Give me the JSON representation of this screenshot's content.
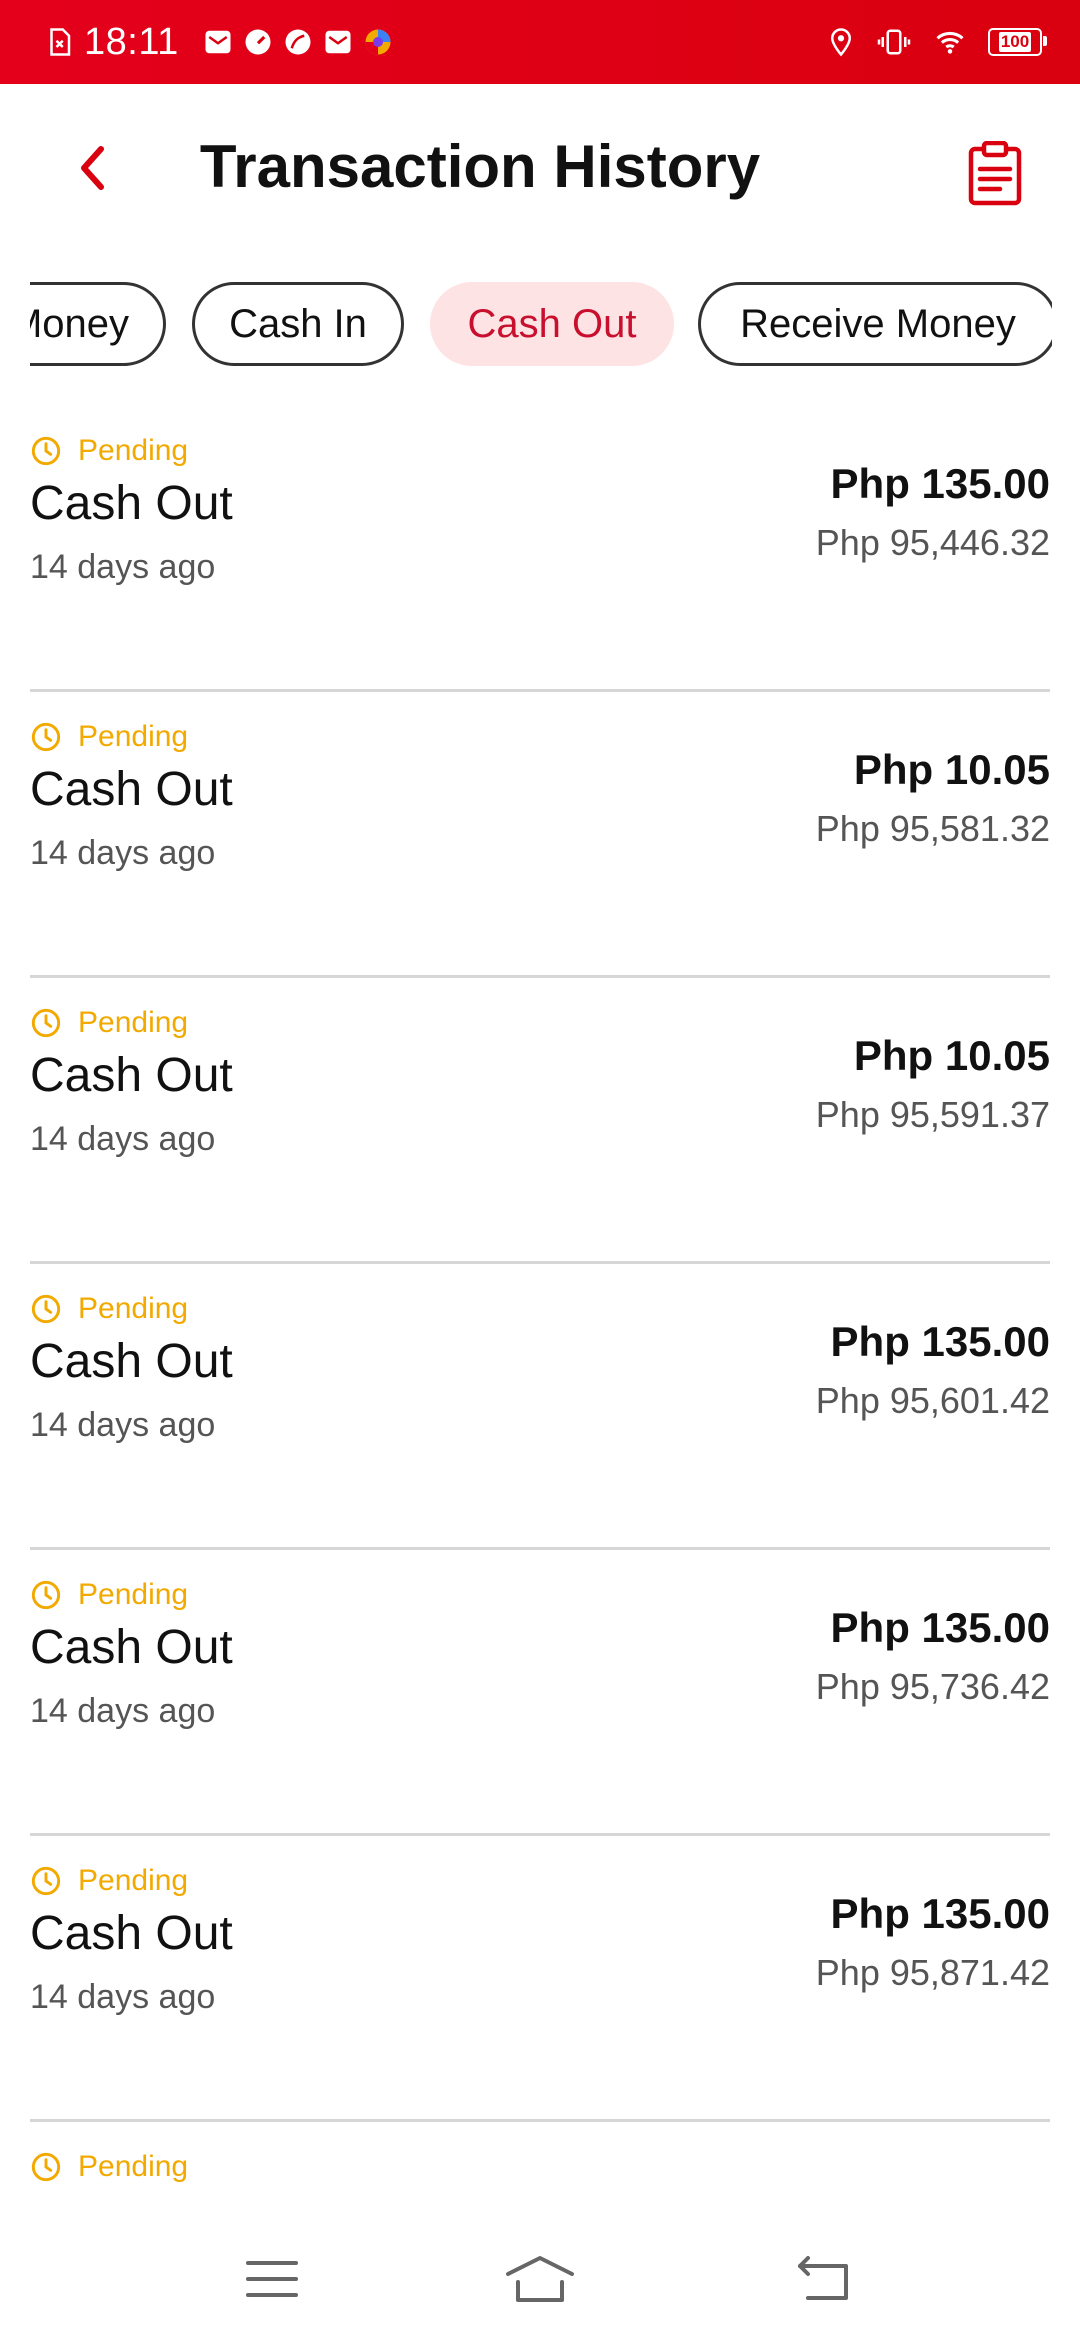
{
  "status_bar": {
    "time": "18:11",
    "battery": "100"
  },
  "header": {
    "title": "Transaction History"
  },
  "tabs": [
    {
      "label": "Money"
    },
    {
      "label": "Cash In"
    },
    {
      "label": "Cash Out"
    },
    {
      "label": "Receive Money"
    }
  ],
  "transactions": [
    {
      "status": "Pending",
      "type": "Cash Out",
      "time": "14 days ago",
      "amount": "Php 135.00",
      "balance": "Php 95,446.32"
    },
    {
      "status": "Pending",
      "type": "Cash Out",
      "time": "14 days ago",
      "amount": "Php 10.05",
      "balance": "Php 95,581.32"
    },
    {
      "status": "Pending",
      "type": "Cash Out",
      "time": "14 days ago",
      "amount": "Php 10.05",
      "balance": "Php 95,591.37"
    },
    {
      "status": "Pending",
      "type": "Cash Out",
      "time": "14 days ago",
      "amount": "Php 135.00",
      "balance": "Php 95,601.42"
    },
    {
      "status": "Pending",
      "type": "Cash Out",
      "time": "14 days ago",
      "amount": "Php 135.00",
      "balance": "Php 95,736.42"
    },
    {
      "status": "Pending",
      "type": "Cash Out",
      "time": "14 days ago",
      "amount": "Php 135.00",
      "balance": "Php 95,871.42"
    }
  ],
  "partial_item": {
    "status": "Pending"
  },
  "colors": {
    "brand_red": "#d9000f",
    "pending": "#f2a900",
    "active_tab_bg": "#fde3e4"
  },
  "icons": {
    "back": "chevron-left-icon",
    "clipboard": "clipboard-icon",
    "clock": "clock-icon",
    "menu": "menu-icon",
    "home": "home-icon",
    "return": "back-icon"
  }
}
